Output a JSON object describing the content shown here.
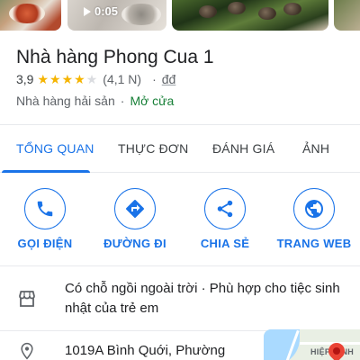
{
  "media": {
    "video_duration": "0:05"
  },
  "place": {
    "name": "Nhà hàng Phong Cua 1",
    "rating": "3,9",
    "stars": 3.9,
    "review_count": "(4,1 N)",
    "separator": "·",
    "price_level": "đđ",
    "category": "Nhà hàng hải sản",
    "open_status": "Mở cửa"
  },
  "tabs": [
    {
      "label": "TỔNG QUAN",
      "active": true
    },
    {
      "label": "THỰC ĐƠN",
      "active": false
    },
    {
      "label": "ĐÁNH GIÁ",
      "active": false
    },
    {
      "label": "ẢNH",
      "active": false
    }
  ],
  "actions": [
    {
      "label": "GỌI ĐIỆN",
      "icon": "phone-icon"
    },
    {
      "label": "ĐƯỜNG ĐI",
      "icon": "directions-icon"
    },
    {
      "label": "CHIA SẺ",
      "icon": "share-icon"
    },
    {
      "label": "TRANG WEB",
      "icon": "globe-icon"
    }
  ],
  "amenities": {
    "icon": "storefront-icon",
    "text": "Có chỗ ngồi ngoài trời · Phù hợp cho tiệc sinh nhật của trẻ em"
  },
  "address": {
    "icon": "location-pin-icon",
    "text": "1019A Bình Quới, Phường",
    "map_label": "HIỆP BÌNH"
  },
  "colors": {
    "accent": "#1a73e8",
    "star": "#f5b400",
    "open": "#188038",
    "text": "#202124",
    "secondary": "#5f6368"
  }
}
